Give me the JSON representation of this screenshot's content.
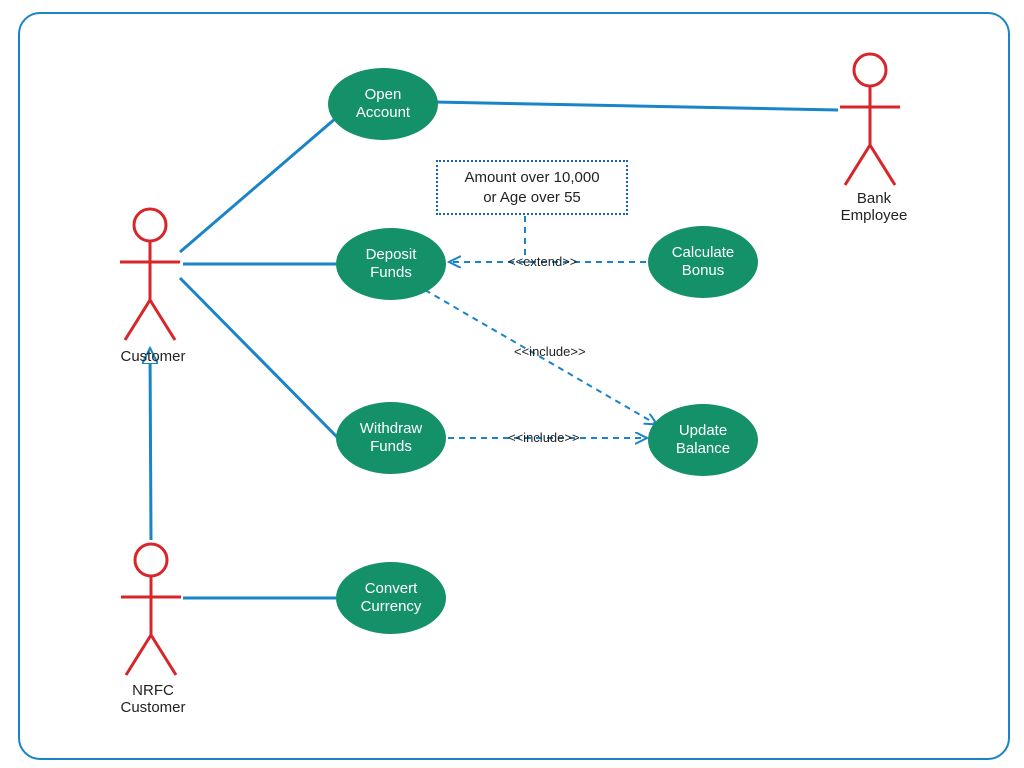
{
  "actors": {
    "customer": "Customer",
    "nrfc": "NRFC\nCustomer",
    "bank": "Bank\nEmployee"
  },
  "usecases": {
    "open": "Open\nAccount",
    "deposit": "Deposit\nFunds",
    "withdraw": "Withdraw\nFunds",
    "convert": "Convert\nCurrency",
    "calcbonus": "Calculate\nBonus",
    "update": "Update\nBalance"
  },
  "note": {
    "condition": "Amount over 10,000\nor Age over 55"
  },
  "stereotypes": {
    "extend": "<<extend>>",
    "include1": "<<include>>",
    "include2": "<<include>>"
  }
}
